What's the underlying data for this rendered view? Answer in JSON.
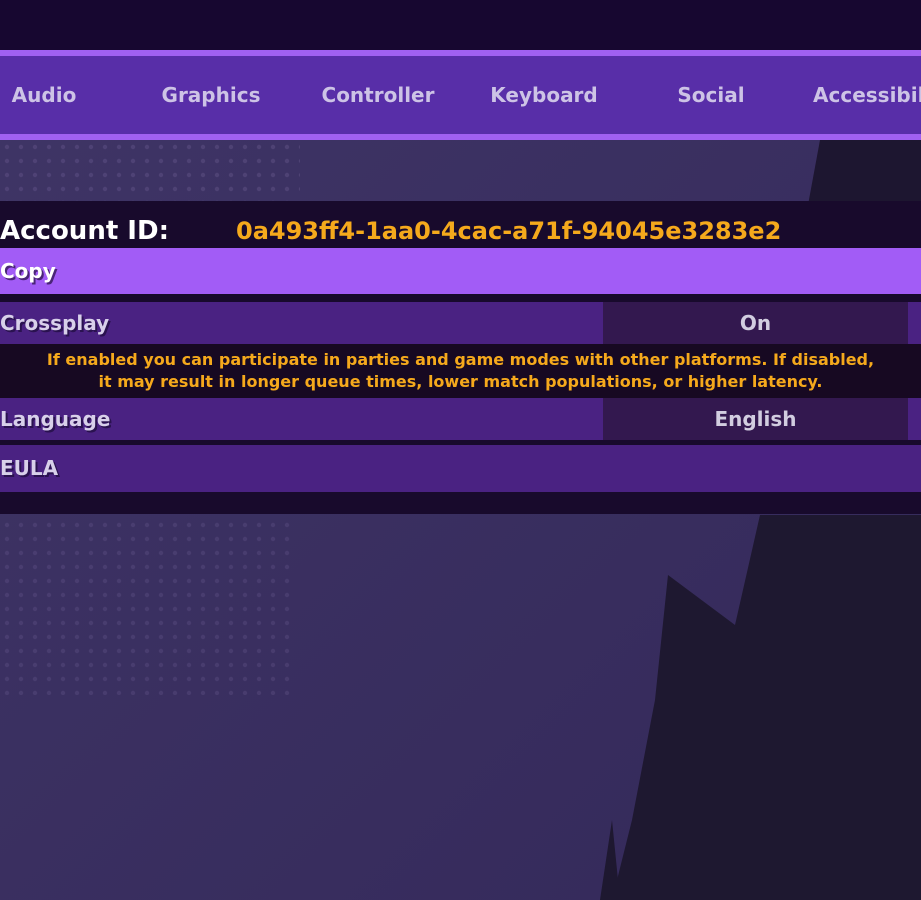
{
  "tabs": [
    {
      "label": "Audio"
    },
    {
      "label": "Graphics"
    },
    {
      "label": "Controller"
    },
    {
      "label": "Keyboard"
    },
    {
      "label": "Social"
    },
    {
      "label": "Accessibili"
    }
  ],
  "account": {
    "label": "Account ID:",
    "value": "0a493ff4-1aa0-4cac-a71f-94045e3283e2",
    "copy_label": "Copy"
  },
  "settings": {
    "crossplay": {
      "label": "Crossplay",
      "value": "On",
      "description_line1": "If enabled you can participate in parties and game modes with other platforms. If disabled,",
      "description_line2": "it may result in longer queue times, lower match populations, or higher latency."
    },
    "language": {
      "label": "Language",
      "value": "English"
    },
    "eula": {
      "label": "EULA"
    }
  },
  "colors": {
    "accent": "#a25cf6",
    "highlight_text": "#f5a91c",
    "tab_bar": "#582ea8",
    "row": "#4a2282",
    "background": "#3c3262"
  }
}
